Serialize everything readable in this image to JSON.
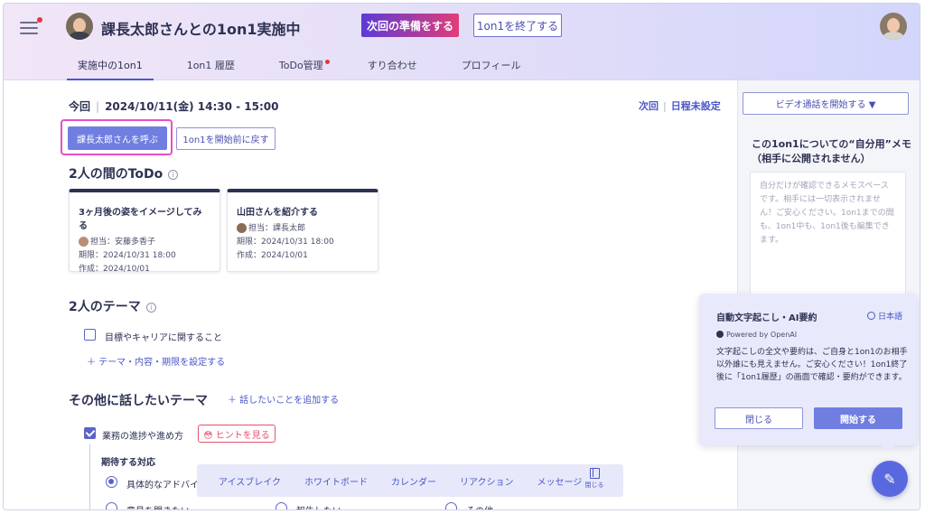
{
  "header": {
    "title": "課長太郎さんとの1on1実施中",
    "prepare_button": "次回の準備をする",
    "end_button": "1on1を終了する",
    "tabs": [
      {
        "label": "実施中の1on1",
        "active": true
      },
      {
        "label": "1on1 履歴"
      },
      {
        "label": "ToDo管理"
      },
      {
        "label": "すり合わせ"
      },
      {
        "label": "プロフィール"
      }
    ]
  },
  "session": {
    "today_label": "今回",
    "datetime": "2024/10/11(金) 14:30 - 15:00",
    "next_label": "次回",
    "next_value": "日程未設定",
    "call_button": "課長太郎さんを呼ぶ",
    "back_button": "1on1を開始前に戻す"
  },
  "todo": {
    "heading": "2人の間のToDo",
    "info_icon": "i",
    "cards": [
      {
        "title": "3ヶ月後の姿をイメージしてみる",
        "assignee": "担当：安藤多香子",
        "due": "期限：2024/10/31 18:00",
        "created": "作成：2024/10/01"
      },
      {
        "title": "山田さんを紹介する",
        "assignee": "担当：課長太郎",
        "due": "期限：2024/10/31 18:00",
        "created": "作成：2024/10/01"
      }
    ]
  },
  "theme": {
    "heading": "2人のテーマ",
    "item": "目標やキャリアに関すること",
    "add_link": "＋ テーマ・内容・期限を設定する"
  },
  "other": {
    "heading": "その他に話したいテーマ",
    "add_link": "＋ 話したいことを追加する",
    "item": "業務の進捗や進め方",
    "hint_button": "😳 ヒントを見る",
    "expect_label": "期待する対応",
    "options": [
      "具体的なアドバイ",
      "意見を聞きたい",
      "報告したい",
      "その他"
    ]
  },
  "toolbar": {
    "items": [
      "アイスブレイク",
      "ホワイトボード",
      "カレンダー",
      "リアクション",
      "メッセージ"
    ],
    "close_label": "閉じる"
  },
  "right": {
    "video_button": "ビデオ通話を開始する ▼",
    "memo_title": "この1on1についての“自分用”メモ（相手に公開されません）",
    "memo_placeholder": "自分だけが確認できるメモスペースです。相手には一切表示されません！ご安心ください。1on1までの間も、1on1中も、1on1後も編集できます。"
  },
  "panel": {
    "title": "自動文字起こし・AI要約",
    "language": "日本語",
    "powered": "Powered by OpenAI",
    "description": "文字起こしの全文や要約は、ご自身と1on1のお相手以外誰にも見えません。ご安心ください！1on1終了後に「1on1履歴」の画面で確認・要約ができます。",
    "close_button": "閉じる",
    "start_button": "開始する"
  }
}
